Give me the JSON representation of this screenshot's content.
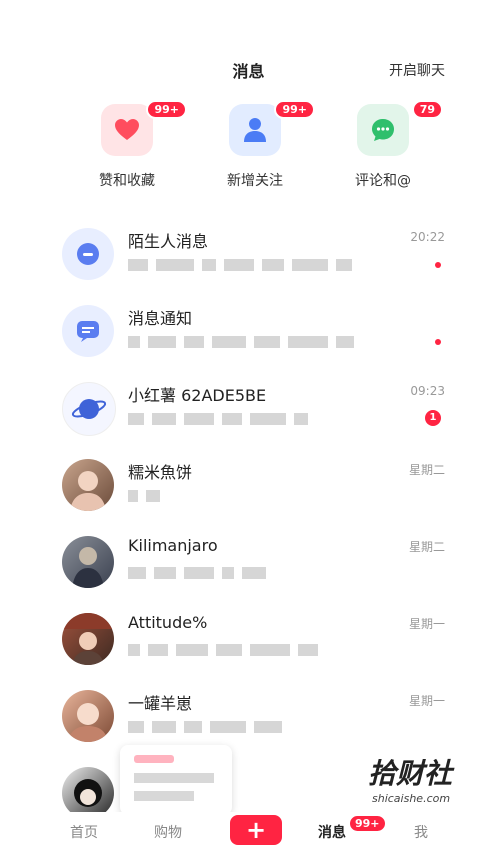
{
  "header": {
    "title": "消息",
    "action": "开启聊天"
  },
  "quick_actions": [
    {
      "label": "赞和收藏",
      "badge": "99+",
      "icon": "heart-icon",
      "bg": "#ffe4e6",
      "color": "#ff4d5e"
    },
    {
      "label": "新增关注",
      "badge": "99+",
      "icon": "person-icon",
      "bg": "#e2ecff",
      "color": "#4b7cf5"
    },
    {
      "label": "评论和@",
      "badge": "79",
      "icon": "chat-icon",
      "bg": "#e2f5ea",
      "color": "#2fbf6c"
    }
  ],
  "messages": [
    {
      "name": "陌生人消息",
      "time": "20:22",
      "unread": ""
    },
    {
      "name": "消息通知",
      "time": "",
      "unread": ""
    },
    {
      "name": "小红薯 62ADE5BE",
      "time": "09:23",
      "unread": "1"
    },
    {
      "name": "糯米魚饼",
      "time": "星期二",
      "unread": ""
    },
    {
      "name": "Kilimanjaro",
      "time": "星期二",
      "unread": ""
    },
    {
      "name": "Attitude%",
      "time": "星期一",
      "unread": ""
    },
    {
      "name": "一罐羊崽",
      "time": "星期一",
      "unread": ""
    }
  ],
  "tabbar": {
    "home": "首页",
    "shop": "购物",
    "plus": "+",
    "messages": "消息",
    "messages_badge": "99+",
    "me": "我"
  },
  "watermark": {
    "main": "拾财社",
    "sub": "shicaishe.com"
  },
  "colors": {
    "accent": "#ff2442"
  }
}
